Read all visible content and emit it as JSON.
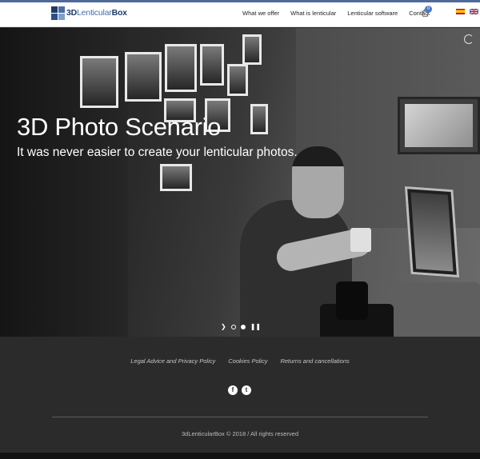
{
  "header": {
    "logo": {
      "bold": "3D",
      "light": "Lenticular",
      "bold2": "Box",
      "colors": [
        "#1f3a66",
        "#4a6fa5",
        "#2c4f86",
        "#7ea0cf"
      ]
    },
    "nav": [
      "What we offer",
      "What is lenticular",
      "Lenticular software",
      "Contact"
    ],
    "cart_count": "0",
    "languages": [
      {
        "name": "flag-es-icon"
      },
      {
        "name": "flag-uk-icon"
      }
    ]
  },
  "hero": {
    "title": "3D Photo Scenario",
    "subtitle": "It was never easier to create your lenticular photos.",
    "slides": {
      "count": 2,
      "active": 2
    }
  },
  "footer": {
    "links": [
      "Legal Advice and Privacy Policy",
      "Cookies Policy",
      "Returns and cancellations"
    ],
    "social": [
      {
        "name": "facebook-icon",
        "glyph": "f"
      },
      {
        "name": "twitter-icon",
        "glyph": "t"
      }
    ],
    "copyright": "3dLenticularBox © 2018 / All rights reserved"
  },
  "colors": {
    "accent": "#4a78c9",
    "footer_bg": "#2b2b2b",
    "top_strip": "#4f6a9b"
  }
}
